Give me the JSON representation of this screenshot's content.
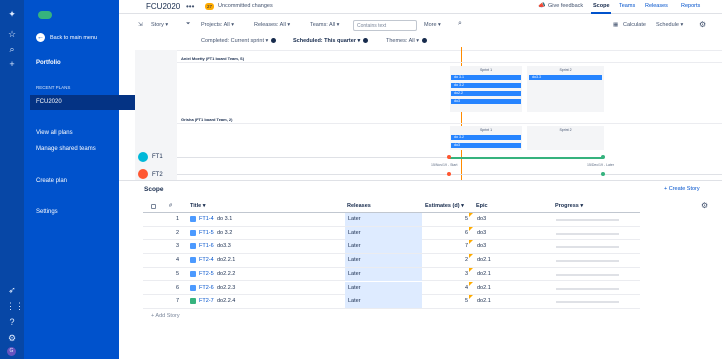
{
  "sidebar": {
    "back": "Back to main menu",
    "portfolio": "Portfolio",
    "recent_plans": "RECENT PLANS",
    "plan": "FCU2020",
    "view_all": "View all plans",
    "manage_teams": "Manage shared teams",
    "create_plan": "Create plan",
    "settings": "Settings"
  },
  "header": {
    "title": "FCU2020",
    "uncommitted_count": "27",
    "uncommitted": "Uncommitted changes",
    "feedback": "Give feedback",
    "tabs": [
      "Scope",
      "Teams",
      "Releases",
      "Reports"
    ]
  },
  "filters": {
    "story": "Story",
    "projects": "Projects: All",
    "releases": "Releases: All",
    "teams": "Teams: All",
    "search_placeholder": "Contains text",
    "more": "More",
    "calculate": "Calculate",
    "schedule": "Schedule",
    "completed": "Completed: Current sprint",
    "scheduled": "Scheduled: This quarter",
    "themes": "Themes: All"
  },
  "timeline": {
    "lane1": "Aniel Moetty (FT1 board Team, S)",
    "lane2": "Grisha (FT1 board Team, 2)",
    "sprint1": "Sprint 1",
    "sprint2": "Sprint 2",
    "lane1_bars": [
      "do 3.1",
      "do 3.2",
      "do2.2",
      "do3"
    ],
    "lane1_bar2": "do3.3",
    "lane2_bars": [
      "do 3.2",
      "do3"
    ],
    "teams": [
      "FT1",
      "FT2"
    ],
    "start_label": "15/Nov/19 - Start",
    "later_label": "15/Dec/19 - Later"
  },
  "scope": {
    "title": "Scope",
    "create_story": "+ Create Story",
    "columns": [
      "Title",
      "Releases",
      "Estimates (d)",
      "Epic",
      "Progress"
    ],
    "rows": [
      {
        "num": "1",
        "key": "FT1-4",
        "title": "do 3.1",
        "release": "Later",
        "estimate": "5",
        "epic": "do3",
        "type": "story"
      },
      {
        "num": "2",
        "key": "FT1-5",
        "title": "do 3.2",
        "release": "Later",
        "estimate": "6",
        "epic": "do3",
        "type": "story"
      },
      {
        "num": "3",
        "key": "FT1-6",
        "title": "do3.3",
        "release": "Later",
        "estimate": "7",
        "epic": "do3",
        "type": "story"
      },
      {
        "num": "4",
        "key": "FT2-4",
        "title": "do2.2.1",
        "release": "Later",
        "estimate": "2",
        "epic": "do2.1",
        "type": "story"
      },
      {
        "num": "5",
        "key": "FT2-5",
        "title": "do2.2.2",
        "release": "Later",
        "estimate": "3",
        "epic": "do2.1",
        "type": "story"
      },
      {
        "num": "6",
        "key": "FT2-6",
        "title": "do2.2.3",
        "release": "Later",
        "estimate": "4",
        "epic": "do2.1",
        "type": "story"
      },
      {
        "num": "7",
        "key": "FT2-7",
        "title": "do2.2.4",
        "release": "Later",
        "estimate": "5",
        "epic": "do2.1",
        "type": "task"
      }
    ],
    "add_story": "+ Add Story"
  }
}
